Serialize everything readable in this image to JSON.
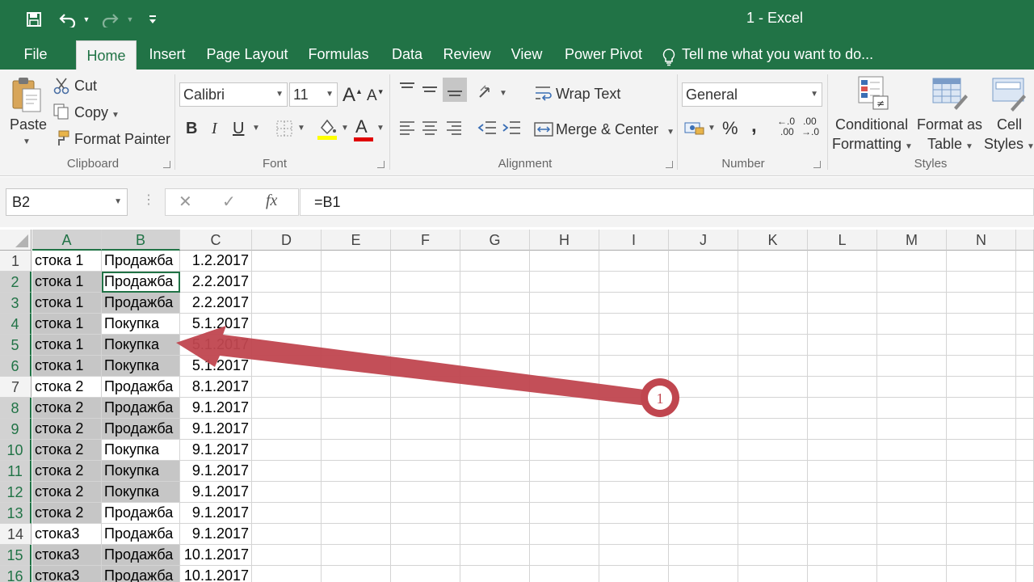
{
  "window": {
    "title": "1 - Excel"
  },
  "tabs": [
    {
      "label": "File"
    },
    {
      "label": "Home"
    },
    {
      "label": "Insert"
    },
    {
      "label": "Page Layout"
    },
    {
      "label": "Formulas"
    },
    {
      "label": "Data"
    },
    {
      "label": "Review"
    },
    {
      "label": "View"
    },
    {
      "label": "Power Pivot"
    }
  ],
  "tell_me": "Tell me what you want to do...",
  "ribbon": {
    "clipboard": {
      "paste": "Paste",
      "cut": "Cut",
      "copy": "Copy",
      "format_painter": "Format Painter",
      "label": "Clipboard"
    },
    "font": {
      "name": "Calibri",
      "size": "11",
      "label": "Font",
      "bold": "B",
      "italic": "I",
      "underline": "U",
      "grow": "A",
      "shrink": "A",
      "color_letter": "A"
    },
    "alignment": {
      "wrap_text": "Wrap Text",
      "merge_center": "Merge & Center",
      "label": "Alignment"
    },
    "number": {
      "format": "General",
      "percent": "%",
      "comma": ",",
      "label": "Number",
      "inc_decimal_top": "←.0",
      "inc_decimal_bottom": ".00",
      "dec_decimal_top": ".00",
      "dec_decimal_bottom": "→.0"
    },
    "styles": {
      "conditional_1": "Conditional",
      "conditional_2": "Formatting",
      "format_table_1": "Format as",
      "format_table_2": "Table",
      "cell_styles_1": "Cell",
      "cell_styles_2": "Styles",
      "label": "Styles"
    }
  },
  "formula_bar": {
    "name_box": "B2",
    "cancel": "✕",
    "enter": "✓",
    "fx": "fx",
    "formula": "=B1"
  },
  "sheet": {
    "columns": [
      "A",
      "B",
      "C",
      "D",
      "E",
      "F",
      "G",
      "H",
      "I",
      "J",
      "K",
      "L",
      "M",
      "N"
    ],
    "rows": [
      {
        "num": "1",
        "a": "стока 1",
        "b": "Продажба",
        "c": "1.2.2017"
      },
      {
        "num": "2",
        "a": "стока 1",
        "b": "Продажба",
        "c": "2.2.2017"
      },
      {
        "num": "3",
        "a": "стока 1",
        "b": "Продажба",
        "c": "2.2.2017"
      },
      {
        "num": "4",
        "a": "стока 1",
        "b": "Покупка",
        "c": "5.1.2017"
      },
      {
        "num": "5",
        "a": "стока 1",
        "b": "Покупка",
        "c": "5.1.2017"
      },
      {
        "num": "6",
        "a": "стока 1",
        "b": "Покупка",
        "c": "5.1.2017"
      },
      {
        "num": "7",
        "a": "стока 2",
        "b": "Продажба",
        "c": "8.1.2017"
      },
      {
        "num": "8",
        "a": "стока 2",
        "b": "Продажба",
        "c": "9.1.2017"
      },
      {
        "num": "9",
        "a": "стока 2",
        "b": "Продажба",
        "c": "9.1.2017"
      },
      {
        "num": "10",
        "a": "стока 2",
        "b": "Покупка",
        "c": "9.1.2017"
      },
      {
        "num": "11",
        "a": "стока 2",
        "b": "Покупка",
        "c": "9.1.2017"
      },
      {
        "num": "12",
        "a": "стока 2",
        "b": "Покупка",
        "c": "9.1.2017"
      },
      {
        "num": "13",
        "a": "стока 2",
        "b": "Продажба",
        "c": "9.1.2017"
      },
      {
        "num": "14",
        "a": "стока3",
        "b": "Продажба",
        "c": "9.1.2017"
      },
      {
        "num": "15",
        "a": "стока3",
        "b": "Продажба",
        "c": "10.1.2017"
      },
      {
        "num": "16",
        "a": "стока3",
        "b": "Продажба",
        "c": "10.1.2017"
      }
    ],
    "highlight_a": [
      2,
      3,
      4,
      5,
      6,
      8,
      9,
      10,
      11,
      12,
      13,
      15,
      16
    ],
    "highlight_b": [
      3,
      5,
      6,
      8,
      9,
      11,
      12,
      15,
      16
    ],
    "active_cell": "B2"
  },
  "annotation": {
    "badge": "1",
    "color": "#c0464f"
  },
  "colors": {
    "accent": "#217346",
    "highlight": "#c6c6c6"
  }
}
